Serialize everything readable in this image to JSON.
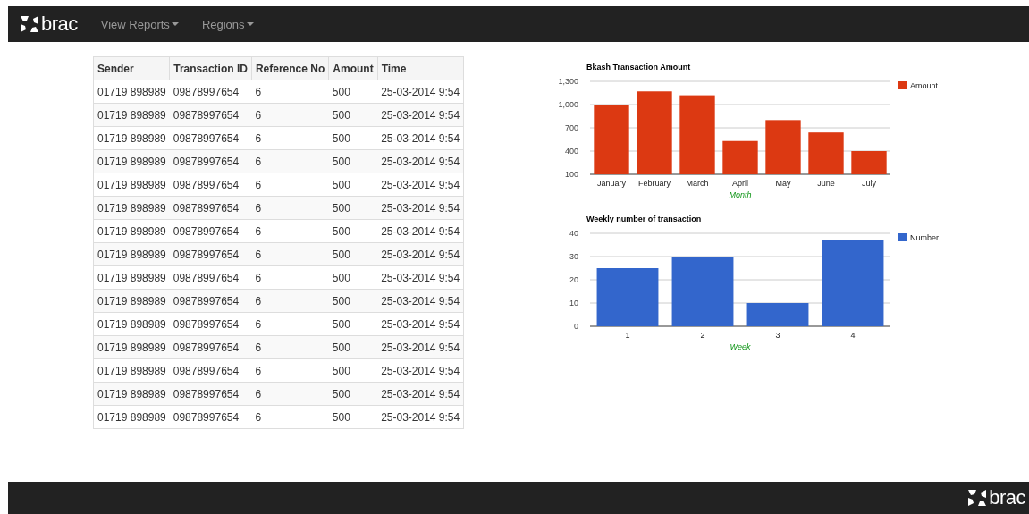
{
  "navbar": {
    "brand": "brac",
    "menus": [
      {
        "label": "View Reports"
      },
      {
        "label": "Regions"
      }
    ]
  },
  "table": {
    "columns": [
      "Sender",
      "Transaction ID",
      "Reference No",
      "Amount",
      "Time"
    ],
    "rows": [
      [
        "01719 898989",
        "09878997654",
        "6",
        "500",
        "25-03-2014 9:54"
      ],
      [
        "01719 898989",
        "09878997654",
        "6",
        "500",
        "25-03-2014 9:54"
      ],
      [
        "01719 898989",
        "09878997654",
        "6",
        "500",
        "25-03-2014 9:54"
      ],
      [
        "01719 898989",
        "09878997654",
        "6",
        "500",
        "25-03-2014 9:54"
      ],
      [
        "01719 898989",
        "09878997654",
        "6",
        "500",
        "25-03-2014 9:54"
      ],
      [
        "01719 898989",
        "09878997654",
        "6",
        "500",
        "25-03-2014 9:54"
      ],
      [
        "01719 898989",
        "09878997654",
        "6",
        "500",
        "25-03-2014 9:54"
      ],
      [
        "01719 898989",
        "09878997654",
        "6",
        "500",
        "25-03-2014 9:54"
      ],
      [
        "01719 898989",
        "09878997654",
        "6",
        "500",
        "25-03-2014 9:54"
      ],
      [
        "01719 898989",
        "09878997654",
        "6",
        "500",
        "25-03-2014 9:54"
      ],
      [
        "01719 898989",
        "09878997654",
        "6",
        "500",
        "25-03-2014 9:54"
      ],
      [
        "01719 898989",
        "09878997654",
        "6",
        "500",
        "25-03-2014 9:54"
      ],
      [
        "01719 898989",
        "09878997654",
        "6",
        "500",
        "25-03-2014 9:54"
      ],
      [
        "01719 898989",
        "09878997654",
        "6",
        "500",
        "25-03-2014 9:54"
      ],
      [
        "01719 898989",
        "09878997654",
        "6",
        "500",
        "25-03-2014 9:54"
      ]
    ]
  },
  "charts": [
    {
      "chart_data": {
        "type": "bar",
        "grid": true,
        "title": "Bkash Transaction Amount",
        "xlabel": "Month",
        "categories": [
          "January",
          "February",
          "March",
          "April",
          "May",
          "June",
          "July"
        ],
        "series": [
          {
            "name": "Amount",
            "color": "#dc3912",
            "values": [
              1000,
              1170,
              1120,
              530,
              800,
              640,
              400
            ]
          }
        ],
        "ylim": [
          100,
          1300
        ],
        "yticks": [
          {
            "value": 100,
            "label": "100"
          },
          {
            "value": 400,
            "label": "400"
          },
          {
            "value": 700,
            "label": "700"
          },
          {
            "value": 1000,
            "label": "1,000"
          },
          {
            "value": 1300,
            "label": "1,300"
          }
        ]
      }
    },
    {
      "chart_data": {
        "type": "bar",
        "grid": true,
        "title": "Weekly number of transaction",
        "xlabel": "Week",
        "categories": [
          "1",
          "2",
          "3",
          "4"
        ],
        "series": [
          {
            "name": "Number",
            "color": "#3366cc",
            "values": [
              25,
              30,
              10,
              37
            ]
          }
        ],
        "ylim": [
          0,
          40
        ],
        "yticks": [
          0,
          10,
          20,
          30,
          40
        ]
      }
    }
  ],
  "footer": {
    "brand": "brac"
  }
}
